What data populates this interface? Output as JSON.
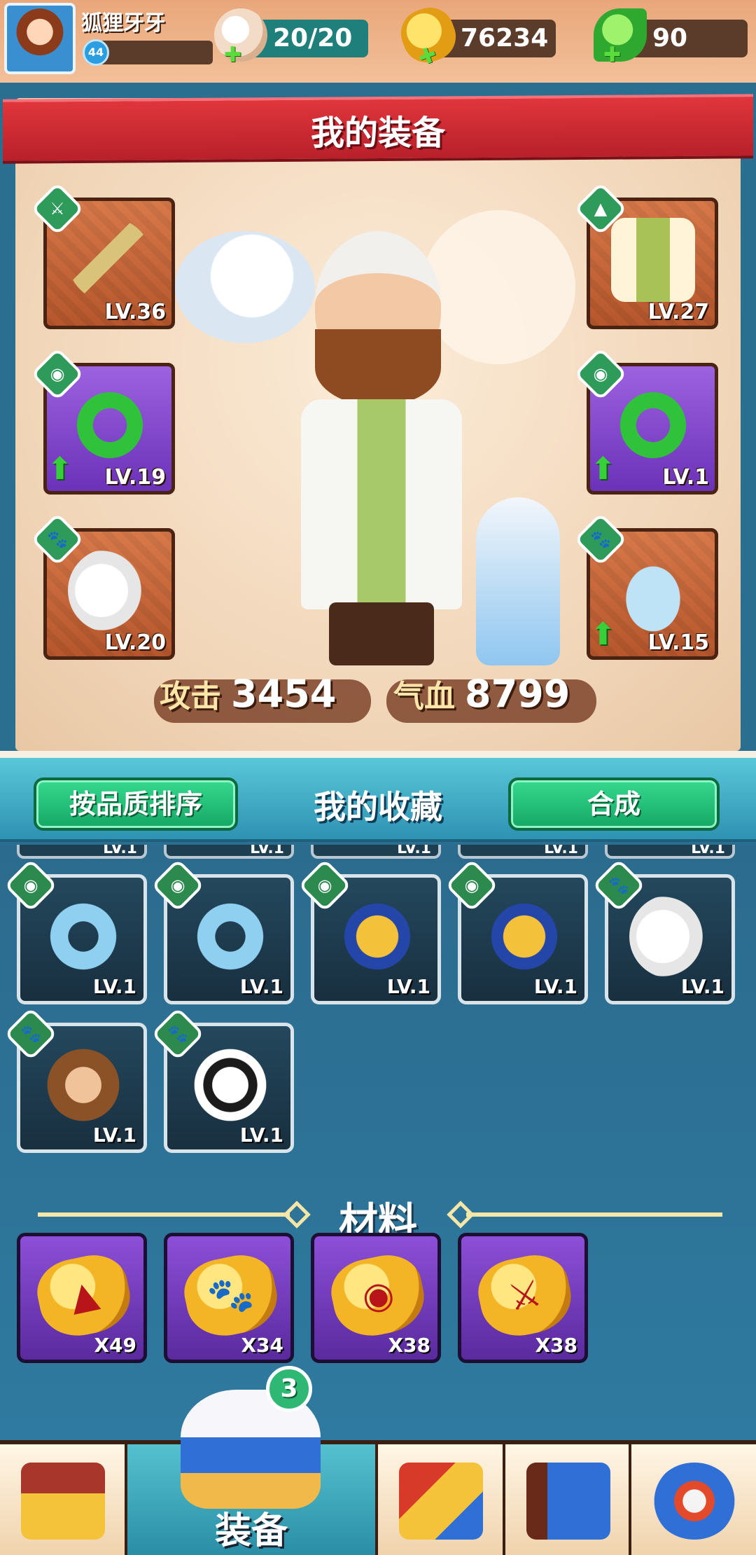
{
  "player": {
    "name": "狐狸牙牙",
    "level": "44",
    "xp_fraction": 0.12
  },
  "resources": {
    "stamina": {
      "value": "20/20",
      "icon": "bun-icon"
    },
    "gold": {
      "value": "76234",
      "icon": "gold-ingot-icon"
    },
    "jade": {
      "value": "90",
      "icon": "green-leaf-gem-icon"
    }
  },
  "equipment": {
    "title": "我的装备",
    "left_slots": [
      {
        "type": "weapon",
        "icon": "sword-icon",
        "level": "LV.36",
        "upgrade": false
      },
      {
        "type": "accessory",
        "icon": "jade-pendant-icon",
        "level": "LV.19",
        "upgrade": true
      },
      {
        "type": "pet",
        "icon": "paw-icon",
        "level": "LV.20",
        "upgrade": false
      }
    ],
    "right_slots": [
      {
        "type": "armor",
        "icon": "armor-icon",
        "level": "LV.27",
        "upgrade": false
      },
      {
        "type": "accessory",
        "icon": "jade-pendant-icon",
        "level": "LV.1",
        "upgrade": true
      },
      {
        "type": "pet",
        "icon": "paw-icon",
        "level": "LV.15",
        "upgrade": true
      }
    ],
    "attack_label": "攻击",
    "attack_value": "3454",
    "hp_label": "气血",
    "hp_value": "8799"
  },
  "collection": {
    "title": "我的收藏",
    "sort_button": "按品质排序",
    "combine_button": "合成",
    "peek_label": "LV.1",
    "items": [
      {
        "kind": "accessory",
        "name": "blue-jade-pendant",
        "level": "LV.1"
      },
      {
        "kind": "accessory",
        "name": "blue-jade-pendant",
        "level": "LV.1"
      },
      {
        "kind": "accessory",
        "name": "gold-gourd-pendant",
        "level": "LV.1"
      },
      {
        "kind": "accessory",
        "name": "gold-gourd-pendant",
        "level": "LV.1"
      },
      {
        "kind": "pet",
        "name": "white-squirrel",
        "level": "LV.1"
      },
      {
        "kind": "pet",
        "name": "monkey",
        "level": "LV.1"
      },
      {
        "kind": "pet",
        "name": "panda",
        "level": "LV.1"
      }
    ]
  },
  "materials": {
    "title": "材料",
    "items": [
      {
        "glyph": "armor",
        "qty": "X49"
      },
      {
        "glyph": "paw",
        "qty": "X34"
      },
      {
        "glyph": "pendant",
        "qty": "X38"
      },
      {
        "glyph": "sword",
        "qty": "X38"
      }
    ]
  },
  "nav": {
    "active_label": "装备",
    "badge_count": "3",
    "items": [
      "shop-icon",
      "equipment-icon",
      "skills-icon",
      "book-icon",
      "settings-icon"
    ]
  },
  "colors": {
    "banner_red": "#d42e36",
    "button_green": "#1fbf78",
    "slot_orange": "#c9683a",
    "slot_purple": "#7f44c8",
    "bg_teal": "#2b6b8e"
  }
}
